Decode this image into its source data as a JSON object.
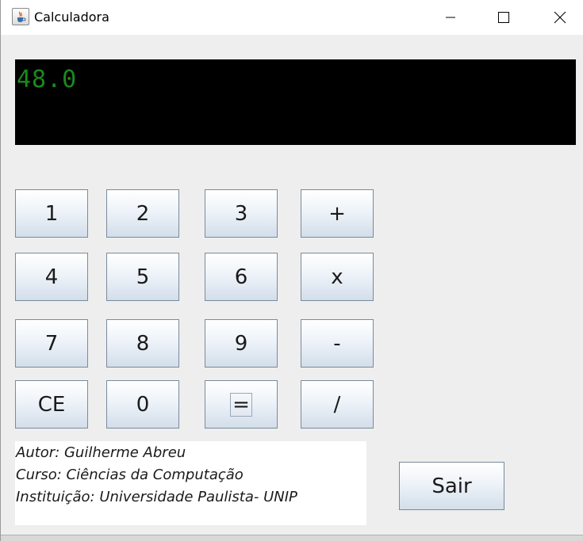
{
  "window": {
    "title": "Calculadora",
    "app_icon": "java-cup-icon",
    "controls": [
      "minimize-icon",
      "maximize-icon",
      "close-icon"
    ]
  },
  "display": {
    "value": "48.0",
    "background_color": "#000000",
    "text_color": "#1a8a1a"
  },
  "keypad": {
    "rows": [
      [
        "1",
        "2",
        "3",
        "+"
      ],
      [
        "4",
        "5",
        "6",
        "x"
      ],
      [
        "7",
        "8",
        "9",
        "-"
      ],
      [
        "CE",
        "0",
        "=",
        "/"
      ]
    ],
    "focused_key": "="
  },
  "info": {
    "author": "Autor: Guilherme Abreu",
    "course": "Curso: Ciências da Computação",
    "institution": "Instituição: Universidade Paulista- UNIP"
  },
  "actions": {
    "exit_label": "Sair"
  }
}
